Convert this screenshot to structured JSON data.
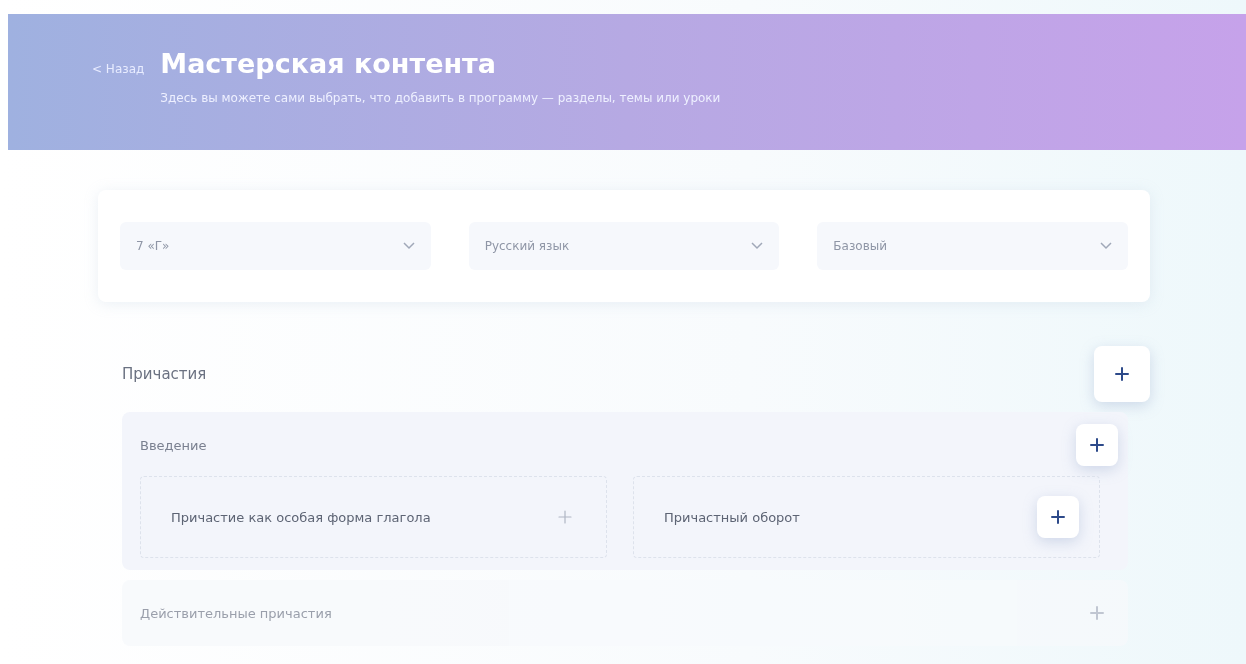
{
  "header": {
    "back": "< Назад",
    "title": "Мастерская контента",
    "subtitle": "Здесь вы можете сами выбрать, что добавить в программу — разделы, темы или уроки"
  },
  "filters": [
    {
      "value": "7 «Г»"
    },
    {
      "value": "Русский язык"
    },
    {
      "value": "Базовый"
    }
  ],
  "section": {
    "title": "Причастия",
    "topics": [
      {
        "title": "Введение",
        "faded": false,
        "lessons": [
          {
            "title": "Причастие как особая форма глагола",
            "highlighted": false
          },
          {
            "title": "Причастный оборот",
            "highlighted": true
          }
        ]
      },
      {
        "title": "Действительные причастия",
        "faded": true
      }
    ]
  }
}
